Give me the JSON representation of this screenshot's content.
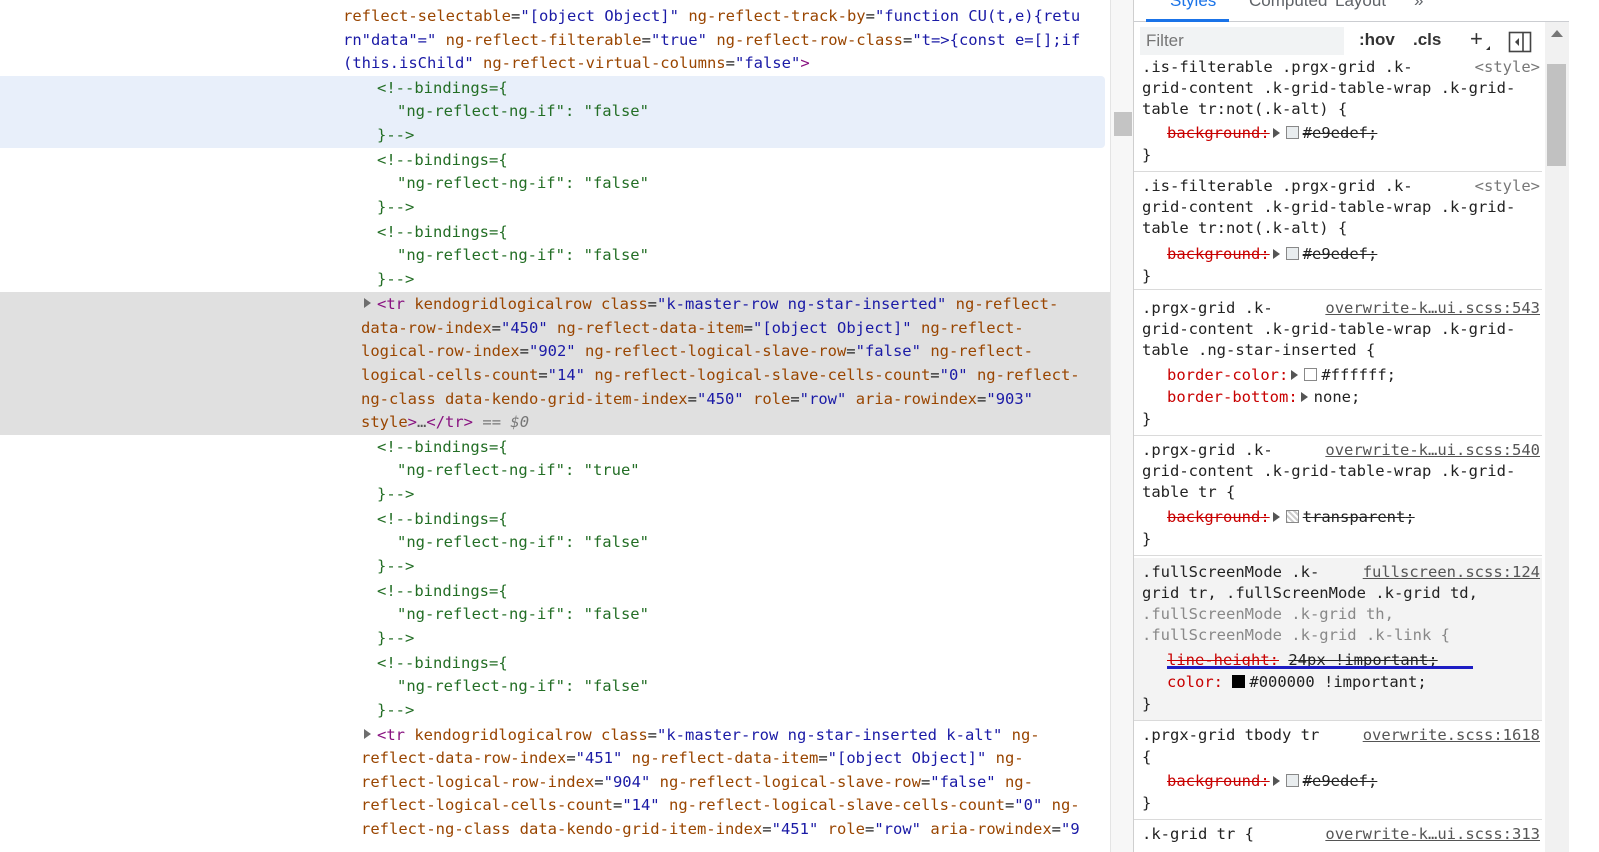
{
  "elements": {
    "attr_lines": {
      "l1": {
        "an1": "reflect-selectable",
        "av1": "\"[object Object]\"",
        "an2": "ng-reflect-track-by",
        "av2": "\"function CU(t,e){retu"
      },
      "l2": {
        "av1": "rn\"data\"=\"",
        "an1": "ng-reflect-filterable",
        "av2": "\"true\"",
        "an2": "ng-reflect-row-class",
        "av3": "\"t=>{const e=[];if"
      },
      "l3": {
        "av1": "(this.isChild\"",
        "an1": "ng-reflect-virtual-columns",
        "av2": "\"false\"",
        "gt": ">"
      }
    },
    "comments": {
      "open": "<!--bindings={",
      "false_line": "\"ng-reflect-ng-if\": \"false\"",
      "true_line": "\"ng-reflect-ng-if\": \"true\"",
      "close": "}-->"
    },
    "row_450": {
      "lines": [
        {
          "tg": "<tr",
          "an1": "kendogridlogicalrow",
          "an2": "class",
          "av2": "\"k-master-row ng-star-inserted\"",
          "an3": "ng-reflect-"
        },
        {
          "an1": "data-row-index",
          "av1": "\"450\"",
          "an2": "ng-reflect-data-item",
          "av2": "\"[object Object]\"",
          "an3": "ng-reflect-"
        },
        {
          "an1": "logical-row-index",
          "av1": "\"902\"",
          "an2": "ng-reflect-logical-slave-row",
          "av2": "\"false\"",
          "an3": "ng-reflect-"
        },
        {
          "an1": "logical-cells-count",
          "av1": "\"14\"",
          "an2": "ng-reflect-logical-slave-cells-count",
          "av2": "\"0\"",
          "an3": "ng-reflect-"
        },
        {
          "an1": "ng-class",
          "an2": "data-kendo-grid-item-index",
          "av2": "\"450\"",
          "an3": "role",
          "av3": "\"row\"",
          "an4": "aria-rowindex",
          "av4": "\"903\""
        },
        {
          "an1": "style",
          "tg1": ">",
          "ellipsis": "…",
          "tg2": "</tr>",
          "eq": " == ",
          "dollar": "$0"
        }
      ]
    },
    "row_451": {
      "lines": [
        {
          "tg": "<tr",
          "an1": "kendogridlogicalrow",
          "an2": "class",
          "av2": "\"k-master-row ng-star-inserted k-alt\"",
          "an3": "ng-"
        },
        {
          "an1": "reflect-data-row-index",
          "av1": "\"451\"",
          "an2": "ng-reflect-data-item",
          "av2": "\"[object Object]\"",
          "an3": "ng-"
        },
        {
          "an1": "reflect-logical-row-index",
          "av1": "\"904\"",
          "an2": "ng-reflect-logical-slave-row",
          "av2": "\"false\"",
          "an3": "ng-"
        },
        {
          "an1": "reflect-logical-cells-count",
          "av1": "\"14\"",
          "an2": "ng-reflect-logical-slave-cells-count",
          "av2": "\"0\"",
          "an3": "ng-"
        },
        {
          "an1": "reflect-ng-class",
          "an2": "data-kendo-grid-item-index",
          "av2": "\"451\"",
          "an3": "role",
          "av3": "\"row\"",
          "an4": "aria-rowindex",
          "av4": "\"9"
        }
      ]
    }
  },
  "styles_pane": {
    "tabs": [
      "Styles",
      "Computed",
      "Layout",
      "»"
    ],
    "active_tab": "Styles",
    "filter_placeholder": "Filter",
    "hov": ":hov",
    "cls": ".cls",
    "plus": "+",
    "rules": [
      {
        "selector_lines": [
          ".is-filterable .prgx-grid .k-",
          "grid-content .k-grid-table-wrap .k-grid-",
          "table tr:not(.k-alt) {"
        ],
        "source": "<style>",
        "props": [
          {
            "name": "background",
            "value": "#e9edef",
            "swatch": "#e9edef",
            "struck": true
          }
        ]
      },
      {
        "selector_lines": [
          ".is-filterable .prgx-grid .k-",
          "grid-content .k-grid-table-wrap .k-grid-",
          "table tr:not(.k-alt) {"
        ],
        "source": "<style>",
        "props": [
          {
            "name": "background",
            "value": "#e9edef",
            "swatch": "#e9edef",
            "struck": true
          }
        ]
      },
      {
        "selector_lines": [
          ".prgx-grid .k-",
          "grid-content .k-grid-table-wrap .k-grid-",
          "table .ng-star-inserted {"
        ],
        "source": "overwrite-k…ui.scss:543",
        "props": [
          {
            "name": "border-color",
            "value": "#ffffff",
            "swatch": "#ffffff",
            "struck": false
          },
          {
            "name": "border-bottom",
            "value": "none",
            "swatch": "",
            "struck": false
          }
        ]
      },
      {
        "selector_lines": [
          ".prgx-grid .k-",
          "grid-content .k-grid-table-wrap .k-grid-",
          "table tr {"
        ],
        "source": "overwrite-k…ui.scss:540",
        "props": [
          {
            "name": "background",
            "value": "transparent",
            "swatch": "transparent",
            "struck": true
          }
        ]
      },
      {
        "selector_lines": [
          ".fullScreenMode .k-",
          "grid tr, .fullScreenMode .k-grid td,",
          ".fullScreenMode .k-grid th,",
          ".fullScreenMode .k-grid .k-link {"
        ],
        "source": "fullscreen.scss:124",
        "props": [
          {
            "name": "line-height",
            "value": "24px !important",
            "swatch": "",
            "struck": true
          },
          {
            "name": "color",
            "value": "#000000 !important",
            "swatch": "#000000",
            "struck": false
          }
        ]
      },
      {
        "selector_lines": [
          ".prgx-grid tbody tr",
          "{"
        ],
        "source": "overwrite.scss:1618",
        "props": [
          {
            "name": "background",
            "value": "#e9edef",
            "swatch": "#e9edef",
            "struck": true
          }
        ]
      },
      {
        "selector_lines": [
          ".k-grid tr {"
        ],
        "source": "overwrite-k…ui.scss:313",
        "props": []
      }
    ]
  },
  "colors": {
    "tag": "#881280",
    "attr_name": "#994500",
    "attr_value": "#1a1aa6",
    "comment": "#236e25",
    "selected_row": "#e0e0e0",
    "hover_row": "#e8effa",
    "accent": "#1a73e8",
    "prop_name": "#c80000"
  }
}
